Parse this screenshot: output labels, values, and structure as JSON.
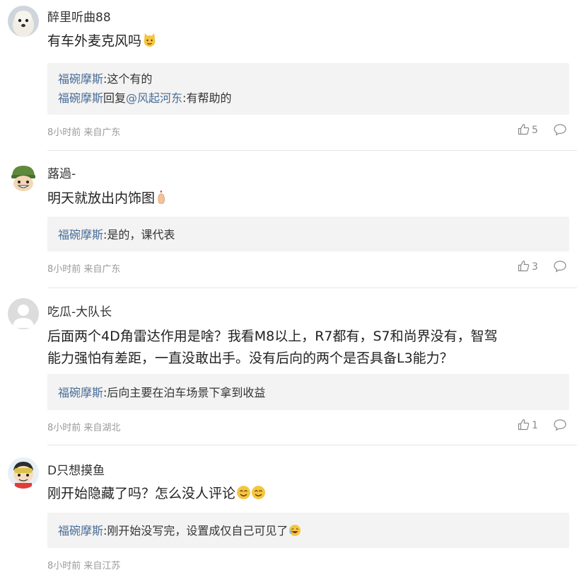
{
  "comments": [
    {
      "username": "醉里听曲88",
      "text": "有车外麦克风吗",
      "emoji": "cat-face-emoji",
      "replies": [
        {
          "author": "福碗摩斯",
          "text": ":这个有的"
        },
        {
          "author": "福碗摩斯",
          "middle": "回复",
          "mention": "@风起河东",
          "text": ":有帮助的"
        }
      ],
      "meta": "8小时前 来自广东",
      "likes": "5"
    },
    {
      "username": "蕗過-",
      "text": "明天就放出内饰图",
      "emoji": "finger-heart-emoji",
      "replies": [
        {
          "author": "福碗摩斯",
          "text": ":是的，课代表"
        }
      ],
      "meta": "8小时前 来自广东",
      "likes": "3"
    },
    {
      "username": "吃瓜-大队长",
      "text_line1": "后面两个4D角雷达作用是啥？我看M8以上，R7都有，S7和尚界没有，智驾",
      "text_line2": "能力强怕有差距，一直没敢出手。没有后向的两个是否具备L3能力？",
      "replies": [
        {
          "author": "福碗摩斯",
          "text": ":后向主要在泊车场景下拿到收益"
        }
      ],
      "meta": "8小时前 来自湖北",
      "likes": "1"
    },
    {
      "username": "D只想摸鱼",
      "text": "刚开始隐藏了吗？怎么没人评论",
      "emoji": "smiling-face-emoji",
      "replies": [
        {
          "author": "福碗摩斯",
          "text": ":刚开始没写完，设置成仅自己可见了",
          "emoji": "laughing-emoji"
        }
      ],
      "meta": "8小时前 来自江苏",
      "likes": ""
    }
  ],
  "icons": {
    "like": "thumbs-up-icon",
    "reply": "speech-bubble-icon"
  },
  "colors": {
    "link": "#4a6e97",
    "reply_box": "#f3f3f3",
    "meta": "#9a9a9a"
  }
}
